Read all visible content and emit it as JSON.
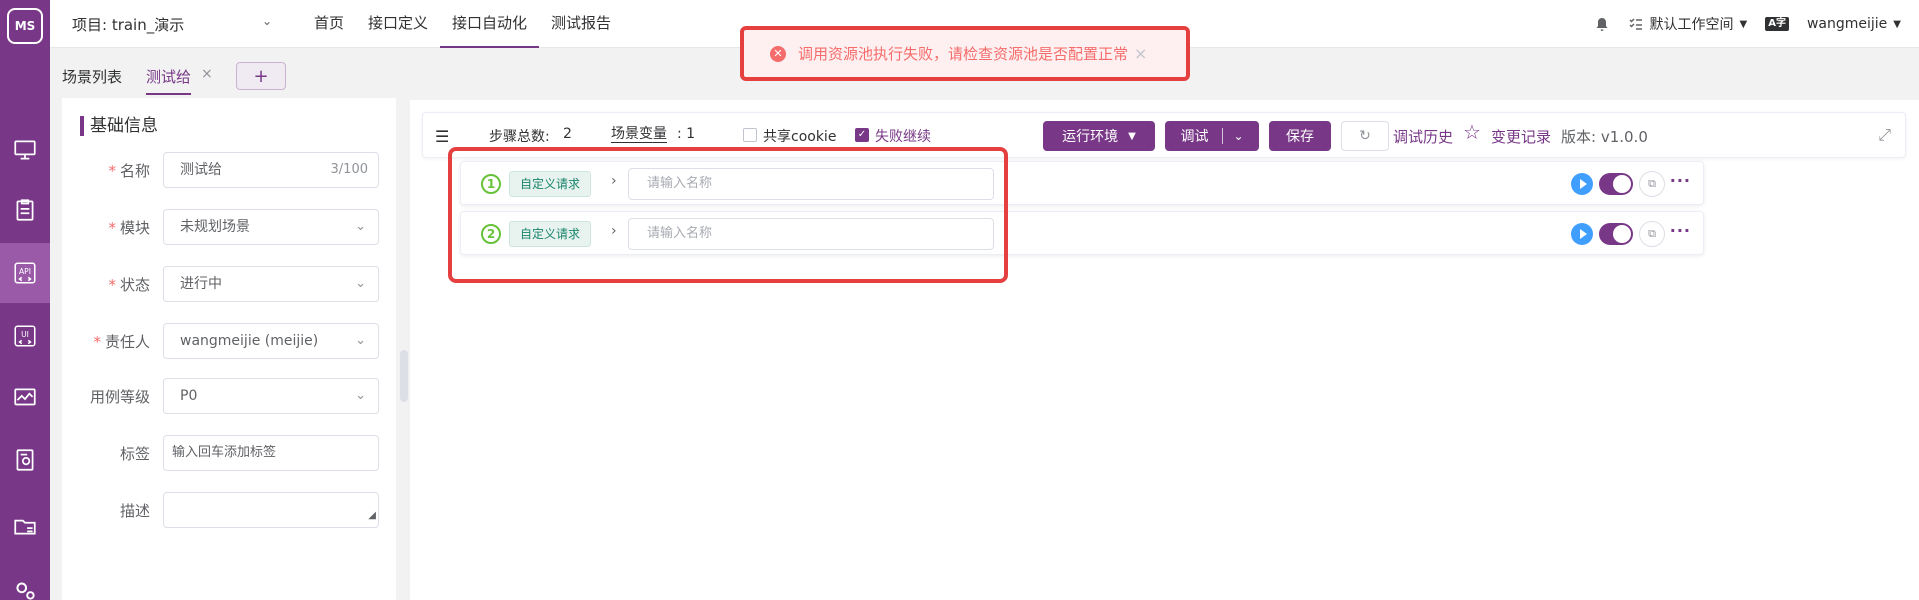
{
  "app": {
    "logo_text": "MS"
  },
  "sidebar": {
    "items": [
      {
        "icon": "monitor-icon"
      },
      {
        "icon": "clipboard-icon"
      },
      {
        "icon": "api-icon",
        "label": "API"
      },
      {
        "icon": "ui-icon",
        "label": "UI"
      },
      {
        "icon": "chart-icon"
      },
      {
        "icon": "report-icon"
      },
      {
        "icon": "folder-icon"
      },
      {
        "icon": "settings-icon"
      }
    ]
  },
  "header": {
    "project": "项目: train_演示",
    "nav": [
      "首页",
      "接口定义",
      "接口自动化",
      "测试报告"
    ],
    "workspace": "默认工作空间",
    "lang_badge": "A字",
    "user": "wangmeijie"
  },
  "toast": {
    "message": "调用资源池执行失败，请检查资源池是否配置正常",
    "close": "×"
  },
  "tabs": {
    "list_label": "场景列表",
    "active_label": "测试给",
    "close": "×",
    "add": "+"
  },
  "info": {
    "title": "基础信息",
    "fields": {
      "name": {
        "label": "名称",
        "value": "测试给",
        "count": "3/100"
      },
      "module": {
        "label": "模块",
        "value": "未规划场景"
      },
      "status": {
        "label": "状态",
        "value": "进行中"
      },
      "owner": {
        "label": "责任人",
        "value": "wangmeijie (meijie)"
      },
      "level": {
        "label": "用例等级",
        "value": "P0"
      },
      "tags": {
        "label": "标签",
        "placeholder": "输入回车添加标签"
      },
      "desc": {
        "label": "描述"
      }
    }
  },
  "toolbar": {
    "steps_label": "步骤总数:",
    "steps_count": "2",
    "vars_label": "场景变量",
    "vars_count": ": 1",
    "share_cookie": "共享cookie",
    "continue_on_fail": "失败继续",
    "env_button": "运行环境",
    "debug_button": "调试",
    "save_button": "保存",
    "history": "调试历史",
    "changelog": "变更记录",
    "version": "版本: v1.0.0"
  },
  "steps": [
    {
      "index": "1",
      "type": "自定义请求",
      "placeholder": "请输入名称"
    },
    {
      "index": "2",
      "type": "自定义请求",
      "placeholder": "请输入名称"
    }
  ]
}
